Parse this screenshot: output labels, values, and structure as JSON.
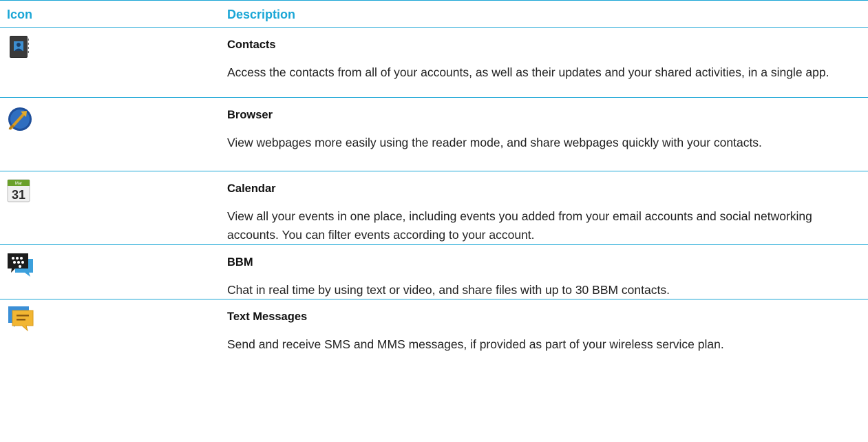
{
  "header": {
    "icon_col": "Icon",
    "desc_col": "Description"
  },
  "colors": {
    "accent": "#1aa6d6"
  },
  "rows": [
    {
      "icon": "contacts-icon",
      "title": "Contacts",
      "text": "Access the contacts from all of your accounts, as well as their updates and your shared activities, in a single app."
    },
    {
      "icon": "browser-icon",
      "title": "Browser",
      "text": "View webpages more easily using the reader mode, and share webpages quickly with your contacts."
    },
    {
      "icon": "calendar-icon",
      "title": "Calendar",
      "calendar_month": "Mar",
      "calendar_day": "31",
      "text": "View all your events in one place, including events you added from your email accounts and social networking accounts. You can filter events according to your account."
    },
    {
      "icon": "bbm-icon",
      "title": "BBM",
      "text": "Chat in real time by using text or video, and share files with up to 30 BBM contacts."
    },
    {
      "icon": "text-messages-icon",
      "title": "Text Messages",
      "text": "Send and receive SMS and MMS messages, if provided as part of your wireless service plan."
    }
  ]
}
